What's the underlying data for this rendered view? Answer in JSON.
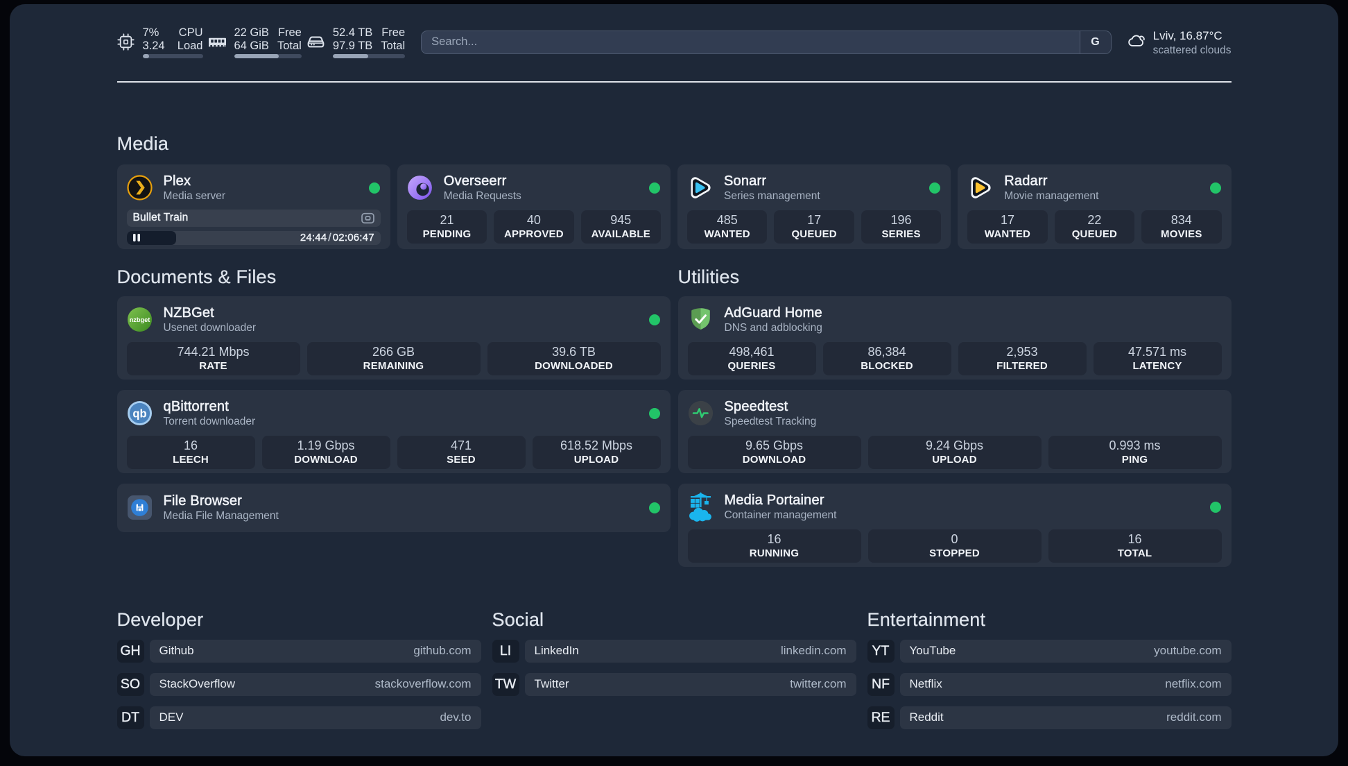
{
  "theme": {
    "status_online_color": "#22c468",
    "progress_fill_color": "#99a5b7",
    "accent_plex": "#ebaf1c"
  },
  "topbar": {
    "resources": [
      {
        "icon": "cpu-icon",
        "values": [
          "7%",
          "3.24"
        ],
        "labels": [
          "CPU",
          "Load"
        ],
        "percent": 7
      },
      {
        "icon": "memory-icon",
        "values": [
          "22 GiB",
          "64 GiB"
        ],
        "labels": [
          "Free",
          "Total"
        ],
        "percent": 66
      },
      {
        "icon": "disk-icon",
        "values": [
          "52.4 TB",
          "97.9 TB"
        ],
        "labels": [
          "Free",
          "Total"
        ],
        "percent": 49
      }
    ],
    "search": {
      "placeholder": "Search...",
      "button": "G"
    },
    "weather": {
      "icon": "cloud-icon",
      "summary": "Lviv, 16.87°C",
      "condition": "scattered clouds"
    }
  },
  "groups": {
    "media": {
      "title": "Media"
    },
    "documents": {
      "title": "Documents & Files"
    },
    "utilities": {
      "title": "Utilities"
    }
  },
  "services": {
    "plex": {
      "title": "Plex",
      "subtitle": "Media server",
      "status": "online",
      "now_playing": {
        "title": "Bullet Train",
        "elapsed": "24:44",
        "separator": "/",
        "duration": "02:06:47",
        "progress_percent": 19.5
      }
    },
    "overseerr": {
      "title": "Overseerr",
      "subtitle": "Media Requests",
      "status": "online",
      "stats": [
        {
          "value": "21",
          "label": "PENDING"
        },
        {
          "value": "40",
          "label": "APPROVED"
        },
        {
          "value": "945",
          "label": "AVAILABLE"
        }
      ]
    },
    "sonarr": {
      "title": "Sonarr",
      "subtitle": "Series management",
      "status": "online",
      "stats": [
        {
          "value": "485",
          "label": "WANTED"
        },
        {
          "value": "17",
          "label": "QUEUED"
        },
        {
          "value": "196",
          "label": "SERIES"
        }
      ]
    },
    "radarr": {
      "title": "Radarr",
      "subtitle": "Movie management",
      "status": "online",
      "stats": [
        {
          "value": "17",
          "label": "WANTED"
        },
        {
          "value": "22",
          "label": "QUEUED"
        },
        {
          "value": "834",
          "label": "MOVIES"
        }
      ]
    },
    "nzbget": {
      "title": "NZBGet",
      "subtitle": "Usenet downloader",
      "status": "online",
      "stats": [
        {
          "value": "744.21 Mbps",
          "label": "RATE"
        },
        {
          "value": "266 GB",
          "label": "REMAINING"
        },
        {
          "value": "39.6 TB",
          "label": "DOWNLOADED"
        }
      ]
    },
    "qbittorrent": {
      "title": "qBittorrent",
      "subtitle": "Torrent downloader",
      "status": "online",
      "stats": [
        {
          "value": "16",
          "label": "LEECH"
        },
        {
          "value": "1.19 Gbps",
          "label": "DOWNLOAD"
        },
        {
          "value": "471",
          "label": "SEED"
        },
        {
          "value": "618.52 Mbps",
          "label": "UPLOAD"
        }
      ]
    },
    "filebrowser": {
      "title": "File Browser",
      "subtitle": "Media File Management",
      "status": "online"
    },
    "adguard": {
      "title": "AdGuard Home",
      "subtitle": "DNS and adblocking",
      "stats": [
        {
          "value": "498,461",
          "label": "QUERIES"
        },
        {
          "value": "86,384",
          "label": "BLOCKED"
        },
        {
          "value": "2,953",
          "label": "FILTERED"
        },
        {
          "value": "47.571 ms",
          "label": "LATENCY"
        }
      ]
    },
    "speedtest": {
      "title": "Speedtest",
      "subtitle": "Speedtest Tracking",
      "stats": [
        {
          "value": "9.65 Gbps",
          "label": "DOWNLOAD"
        },
        {
          "value": "9.24 Gbps",
          "label": "UPLOAD"
        },
        {
          "value": "0.993 ms",
          "label": "PING"
        }
      ]
    },
    "portainer": {
      "title": "Media Portainer",
      "subtitle": "Container management",
      "status": "online",
      "stats": [
        {
          "value": "16",
          "label": "RUNNING"
        },
        {
          "value": "0",
          "label": "STOPPED"
        },
        {
          "value": "16",
          "label": "TOTAL"
        }
      ]
    }
  },
  "bookmarks": [
    {
      "title": "Developer",
      "items": [
        {
          "abbr": "GH",
          "name": "Github",
          "url": "github.com"
        },
        {
          "abbr": "SO",
          "name": "StackOverflow",
          "url": "stackoverflow.com"
        },
        {
          "abbr": "DT",
          "name": "DEV",
          "url": "dev.to"
        }
      ]
    },
    {
      "title": "Social",
      "items": [
        {
          "abbr": "LI",
          "name": "LinkedIn",
          "url": "linkedin.com"
        },
        {
          "abbr": "TW",
          "name": "Twitter",
          "url": "twitter.com"
        }
      ]
    },
    {
      "title": "Entertainment",
      "items": [
        {
          "abbr": "YT",
          "name": "YouTube",
          "url": "youtube.com"
        },
        {
          "abbr": "NF",
          "name": "Netflix",
          "url": "netflix.com"
        },
        {
          "abbr": "RE",
          "name": "Reddit",
          "url": "reddit.com"
        }
      ]
    }
  ]
}
